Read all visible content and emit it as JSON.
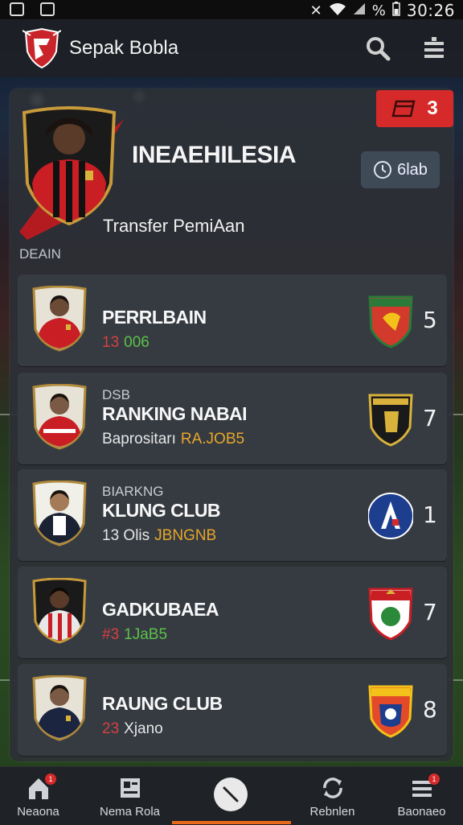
{
  "status_bar": {
    "time": "30:26",
    "battery": "%"
  },
  "header": {
    "title": "Sepak Bobla"
  },
  "hero": {
    "title": "INEAEHILESIA",
    "subtitle": "Transfer PemiAan",
    "section_label": "DEAIN",
    "red_button_count": "3",
    "gray_button_label": "6lab"
  },
  "cards": [
    {
      "pre": "",
      "name": "PERRLBAIN",
      "meta_a": "13",
      "meta_b": "006",
      "rank": "5",
      "badge_color": "#d23b2b"
    },
    {
      "pre": "DSB",
      "name": "RANKING NABAI",
      "meta_a": "Baprositarı",
      "meta_b": "RA.JOB5",
      "rank": "7",
      "badge_color": "#1a1a1a"
    },
    {
      "pre": "BIARKNG",
      "name": "KLUNG CLUB",
      "meta_a": "13 Olis",
      "meta_b": "JBNGNB",
      "rank": "1",
      "badge_color": "#1d3d8f"
    },
    {
      "pre": "",
      "name": "GADKUBAEA",
      "meta_a": "#3",
      "meta_b": "1JaB5",
      "rank": "7",
      "badge_color": "#ffffff"
    },
    {
      "pre": "",
      "name": "RAUNG CLUB",
      "meta_a": "23",
      "meta_b": "Xjano",
      "rank": "8",
      "badge_color": "#e24a2a"
    }
  ],
  "bottom_nav": {
    "items": [
      {
        "label": "Neaona",
        "badge": "1"
      },
      {
        "label": "Nema Rola",
        "badge": ""
      },
      {
        "label": "Rebnlen",
        "badge": ""
      },
      {
        "label": "Baonaeo",
        "badge": "1"
      }
    ]
  },
  "colors": {
    "accent_red": "#d62a2a",
    "panel": "#2c3036",
    "card": "#363b42",
    "orange": "#e86a1a"
  }
}
